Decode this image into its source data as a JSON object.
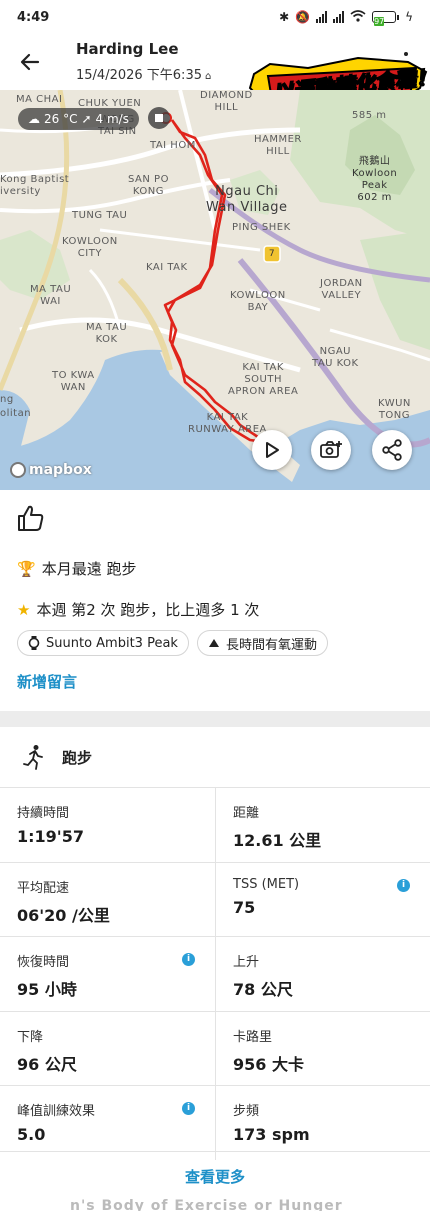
{
  "status_bar": {
    "time": "4:49",
    "battery": "97"
  },
  "header": {
    "name": "Harding Lee",
    "date": "15/4/2026 下午6:35",
    "banner_text": "以運動轉化食糧！"
  },
  "map": {
    "weather_temp": "26 °C",
    "weather_wind": "4 m/s",
    "attribution": "mapbox",
    "labels": {
      "ma_chai": "MA CHAI",
      "chuk_yuen": "CHUK YUEN",
      "wong_tai_sin": "WONG\nTAI SIN",
      "diamond_hill": "DIAMOND\nHILL",
      "tai_hom": "TAI HOM",
      "hammer_hill": "HAMMER\nHILL",
      "san_po_kong": "SAN PO\nKONG",
      "ngau_chi_wan": "Ngau Chi\nWan Village",
      "kowloon_peak": "飛鵝山\nKowloon\nPeak\n602 m",
      "elev_585": "585 m",
      "kong_baptist": "Kong Baptist\niversity",
      "tung_tau": "TUNG TAU",
      "ping_shek": "PING SHEK",
      "kowloon_city": "KOWLOON\nCITY",
      "route7": "7",
      "kai_tak": "KAI TAK",
      "jordan_valley": "JORDAN\nVALLEY",
      "ma_tau_wai": "MA TAU\nWAI",
      "kowloon_bay": "KOWLOON\nBAY",
      "ma_tau_kok": "MA TAU\nKOK",
      "ngau_tau_kok": "NGAU\nTAU KOK",
      "to_kwa_wan": "TO KWA\nWAN",
      "kai_tak_south": "KAI TAK\nSOUTH\nAPRON AREA",
      "ng": "ng",
      "olitan": "olitan",
      "kai_tak_runway": "KAI TAK\nRUNWAY AREA",
      "kwun_tong": "KWUN\nTONG"
    }
  },
  "social": {
    "achievement_1": "本月最遠 跑步",
    "achievement_2": "本週 第2 次 跑步，比上週多 1 次",
    "chips": [
      "Suunto Ambit3 Peak",
      "長時間有氧運動"
    ],
    "add_comment": "新增留言"
  },
  "activity": {
    "type": "跑步",
    "stats": [
      {
        "label": "持續時間",
        "value": "1:19'57"
      },
      {
        "label": "距離",
        "value": "12.61 公里"
      },
      {
        "label": "平均配速",
        "value": "06'20 /公里"
      },
      {
        "label": "TSS (MET)",
        "value": "75"
      },
      {
        "label": "恢復時間",
        "value": "95 小時"
      },
      {
        "label": "上升",
        "value": "78 公尺"
      },
      {
        "label": "下降",
        "value": "96 公尺"
      },
      {
        "label": "卡路里",
        "value": "956 大卡"
      },
      {
        "label": "峰值訓練效果",
        "value": "5.0"
      },
      {
        "label": "步頻",
        "value": "173 spm"
      }
    ],
    "see_more": "查看更多"
  },
  "bottom_overlay_text": "n's Body of Exercise or Hunger",
  "colors": {
    "accent": "#1e90c8",
    "route": "#e0241b",
    "water": "#a9c8e3",
    "park": "#cfe2c0"
  }
}
